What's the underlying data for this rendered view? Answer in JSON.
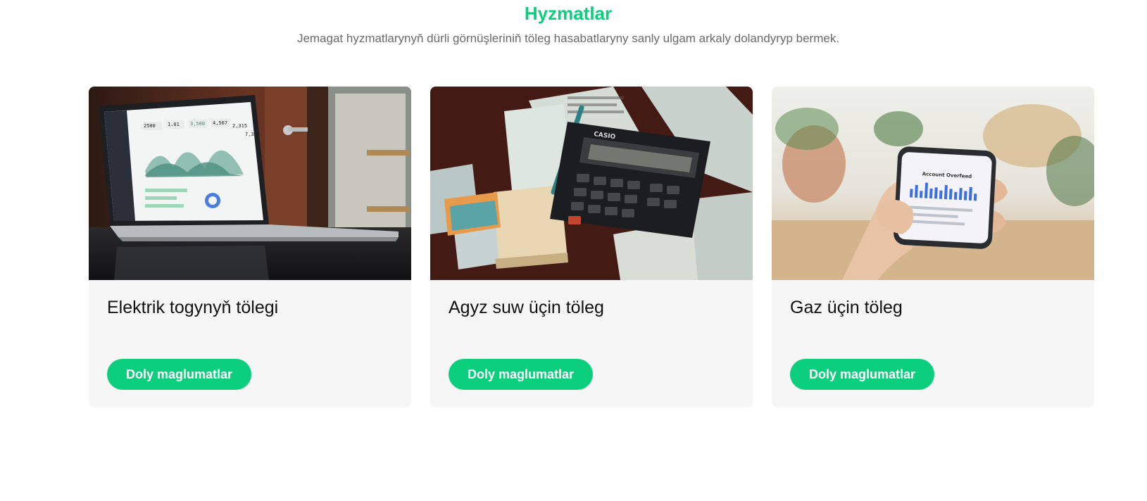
{
  "section": {
    "title": "Hyzmatlar",
    "subtitle": "Jemagat hyzmatlarynyň dürli görnüşleriniň töleg hasabatlaryny sanly ulgam arkaly dolandyryp bermek."
  },
  "cards": [
    {
      "title": "Elektrik togynyň tölegi",
      "button_label": "Doly maglumatlar",
      "image": "laptop-dashboard-photo"
    },
    {
      "title": "Agyz suw üçin töleg",
      "button_label": "Doly maglumatlar",
      "image": "calculator-receipts-photo"
    },
    {
      "title": "Gaz üçin töleg",
      "button_label": "Doly maglumatlar",
      "image": "phone-in-hand-photo"
    }
  ],
  "colors": {
    "accent": "#0ccf7e",
    "card_background": "#f6f6f6",
    "subtitle": "#6a6a6a"
  },
  "photo_text": {
    "laptop_stats": [
      "2500",
      "1.01",
      "3,500",
      "4,567",
      "2,315",
      "7,325"
    ],
    "calculator_brand": "CASIO",
    "phone_heading": "Account Overfeed"
  }
}
